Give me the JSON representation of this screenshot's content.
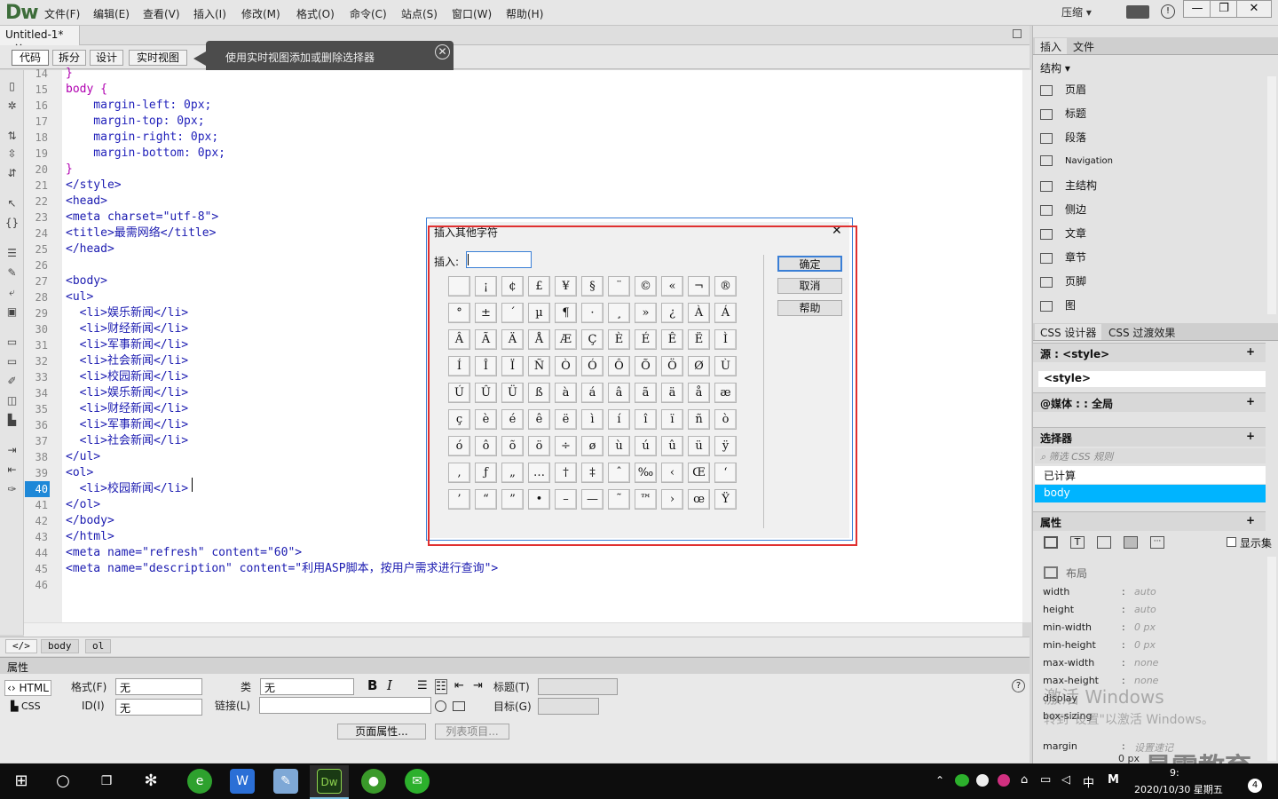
{
  "app": {
    "logo": "Dw",
    "menus": [
      "文件(F)",
      "编辑(E)",
      "查看(V)",
      "插入(I)",
      "修改(M)",
      "格式(O)",
      "命令(C)",
      "站点(S)",
      "窗口(W)",
      "帮助(H)"
    ],
    "compress": "压缩",
    "win_controls": [
      "—",
      "❐",
      "✕"
    ]
  },
  "doc": {
    "tab": "Untitled-1*",
    "tab_close": "×",
    "views": [
      "代码",
      "拆分",
      "设计",
      "实时视图"
    ],
    "tip": "使用实时视图添加或删除选择器",
    "tip_close": "✕"
  },
  "code": {
    "line_numbers": [
      "14",
      "15",
      "16",
      "17",
      "18",
      "19",
      "20",
      "21",
      "22",
      "23",
      "24",
      "25",
      "26",
      "27",
      "28",
      "29",
      "30",
      "31",
      "32",
      "33",
      "34",
      "35",
      "36",
      "37",
      "38",
      "39",
      "40",
      "41",
      "42",
      "43",
      "44",
      "45",
      "46"
    ],
    "current_line": "40",
    "lines": [
      "}",
      "body {",
      "    margin-left: 0px;",
      "    margin-top: 0px;",
      "    margin-right: 0px;",
      "    margin-bottom: 0px;",
      "}",
      "</style>",
      "<head>",
      "<meta charset=\"utf-8\">",
      "<title>最需网络</title>",
      "</head>",
      "",
      "<body>",
      "<ul>",
      "  <li>娱乐新闻</li>",
      "  <li>财经新闻</li>",
      "  <li>军事新闻</li>",
      "  <li>社会新闻</li>",
      "  <li>校园新闻</li>",
      "  <li>娱乐新闻</li>",
      "  <li>财经新闻</li>",
      "  <li>军事新闻</li>",
      "  <li>社会新闻</li>",
      "</ul>",
      "<ol>",
      "  <li>校园新闻</li>",
      "</ol>",
      "</body>",
      "</html>",
      "<meta name=\"refresh\" content=\"60\">",
      "<meta name=\"description\" content=\"利用ASP脚本，按用户需求进行查询\">",
      ""
    ]
  },
  "tagbar": {
    "code_icon": "</>",
    "tags": [
      "body",
      "ol"
    ]
  },
  "properties": {
    "title": "属性",
    "html_btn": "HTML",
    "css_btn": "CSS",
    "format_label": "格式(F)",
    "format_value": "无",
    "class_label": "类",
    "class_value": "无",
    "id_label": "ID(I)",
    "id_value": "无",
    "link_label": "链接(L)",
    "title_label": "标题(T)",
    "target_label": "目标(G)",
    "page_props": "页面属性...",
    "list_item": "列表项目..."
  },
  "dialog": {
    "title": "插入其他字符",
    "close": "✕",
    "insert_label": "插入:",
    "insert_value": "",
    "ok": "确定",
    "cancel": "取消",
    "help": "帮助",
    "chars": [
      [
        " ",
        "¡",
        "¢",
        "£",
        "¥",
        "§",
        "¨",
        "©",
        "«",
        "¬",
        "®"
      ],
      [
        "°",
        "±",
        "´",
        "µ",
        "¶",
        "·",
        "¸",
        "»",
        "¿",
        "À",
        "Á"
      ],
      [
        "Â",
        "Ã",
        "Ä",
        "Å",
        "Æ",
        "Ç",
        "È",
        "É",
        "Ê",
        "Ë",
        "Ì"
      ],
      [
        "Í",
        "Î",
        "Ï",
        "Ñ",
        "Ò",
        "Ó",
        "Ô",
        "Õ",
        "Ö",
        "Ø",
        "Ù"
      ],
      [
        "Ú",
        "Û",
        "Ü",
        "ß",
        "à",
        "á",
        "â",
        "ã",
        "ä",
        "å",
        "æ"
      ],
      [
        "ç",
        "è",
        "é",
        "ê",
        "ë",
        "ì",
        "í",
        "î",
        "ï",
        "ñ",
        "ò"
      ],
      [
        "ó",
        "ô",
        "õ",
        "ö",
        "÷",
        "ø",
        "ù",
        "ú",
        "û",
        "ü",
        "ÿ"
      ],
      [
        "‚",
        "ƒ",
        "„",
        "…",
        "†",
        "‡",
        "ˆ",
        "‰",
        "‹",
        "Œ",
        "‘"
      ],
      [
        "’",
        "“",
        "”",
        "•",
        "–",
        "—",
        "˜",
        "™",
        "›",
        "œ",
        "Ÿ"
      ]
    ]
  },
  "right_panel": {
    "tabs": [
      "插入",
      "文件"
    ],
    "category": "结构",
    "items": [
      "页眉",
      "标题",
      "段落",
      "Navigation",
      "主结构",
      "侧边",
      "文章",
      "章节",
      "页脚",
      "图"
    ],
    "css_tabs": [
      "CSS 设计器",
      "CSS 过渡效果"
    ],
    "source_label": "源 : <style>",
    "source_item": "<style>",
    "media_label": "@媒体 : : 全局",
    "selector_label": "选择器",
    "selector_filter": "筛选 CSS 规则",
    "computed": "已计算",
    "selected_rule": "body",
    "properties_label": "属性",
    "show_set": "显示集",
    "layout_group": "布局",
    "css_props": [
      {
        "name": "width",
        "value": "auto"
      },
      {
        "name": "height",
        "value": "auto"
      },
      {
        "name": "min-width",
        "value": "0 px"
      },
      {
        "name": "min-height",
        "value": "0 px"
      },
      {
        "name": "max-width",
        "value": "none"
      },
      {
        "name": "max-height",
        "value": "none"
      },
      {
        "name": "display",
        "value": ""
      },
      {
        "name": "box-sizing",
        "value": ""
      },
      {
        "name": "margin",
        "value": "设置速记"
      }
    ],
    "margin_top_value": "0 px"
  },
  "watermark": {
    "line1": "激活 Windows",
    "line2": "转到\"设置\"以激活 Windows。",
    "brand": "最需教育"
  },
  "taskbar": {
    "ime": "中",
    "ime2": "M",
    "date": "2020/10/30 星期五",
    "time": "9:",
    "badge": "4"
  }
}
